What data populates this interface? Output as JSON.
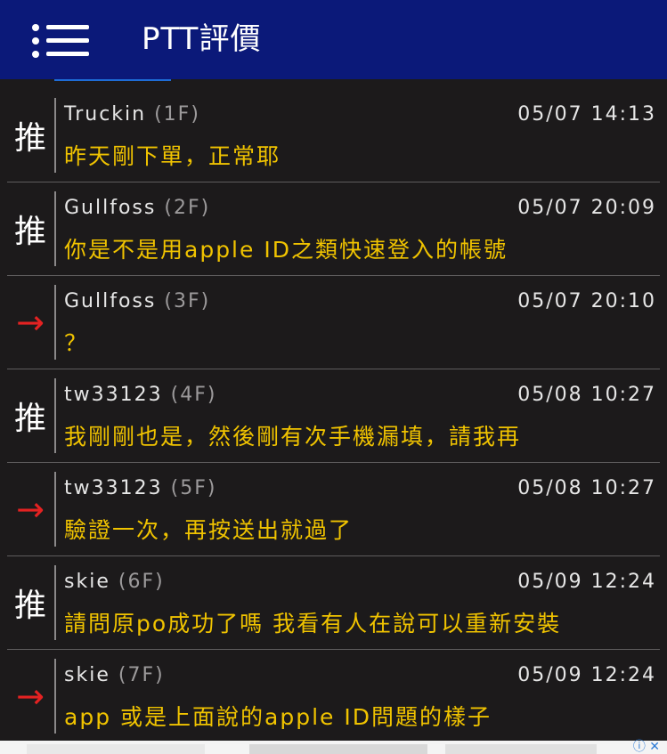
{
  "header": {
    "title": "PTT評價",
    "bg_color": "#0b1979",
    "menu_icon": "hamburger-menu-icon"
  },
  "colors": {
    "background": "#1c1a1b",
    "content_text": "#f0c300",
    "push_arrow": "#e42222"
  },
  "comments": [
    {
      "tag": "推",
      "type": "push",
      "author": "Truckin",
      "floor": "(1F)",
      "time": "05/07 14:13",
      "content": "昨天剛下單，正常耶"
    },
    {
      "tag": "推",
      "type": "push",
      "author": "Gullfoss",
      "floor": "(2F)",
      "time": "05/07 20:09",
      "content": "你是不是用apple ID之類快速登入的帳號"
    },
    {
      "tag": "→",
      "type": "arrow",
      "author": "Gullfoss",
      "floor": "(3F)",
      "time": "05/07 20:10",
      "content": "？"
    },
    {
      "tag": "推",
      "type": "push",
      "author": "tw33123",
      "floor": "(4F)",
      "time": "05/08 10:27",
      "content": "我剛剛也是，然後剛有次手機漏填，請我再"
    },
    {
      "tag": "→",
      "type": "arrow",
      "author": "tw33123",
      "floor": "(5F)",
      "time": "05/08 10:27",
      "content": "驗證一次，再按送出就過了"
    },
    {
      "tag": "推",
      "type": "push",
      "author": "skie",
      "floor": "(6F)",
      "time": "05/09 12:24",
      "content": "請問原po成功了嗎 我看有人在說可以重新安裝"
    },
    {
      "tag": "→",
      "type": "arrow",
      "author": "skie",
      "floor": "(7F)",
      "time": "05/09 12:24",
      "content": "app 或是上面說的apple ID問題的樣子"
    }
  ],
  "ad": {
    "close_icon": "close-icon",
    "info_icon": "ad-info-icon"
  }
}
